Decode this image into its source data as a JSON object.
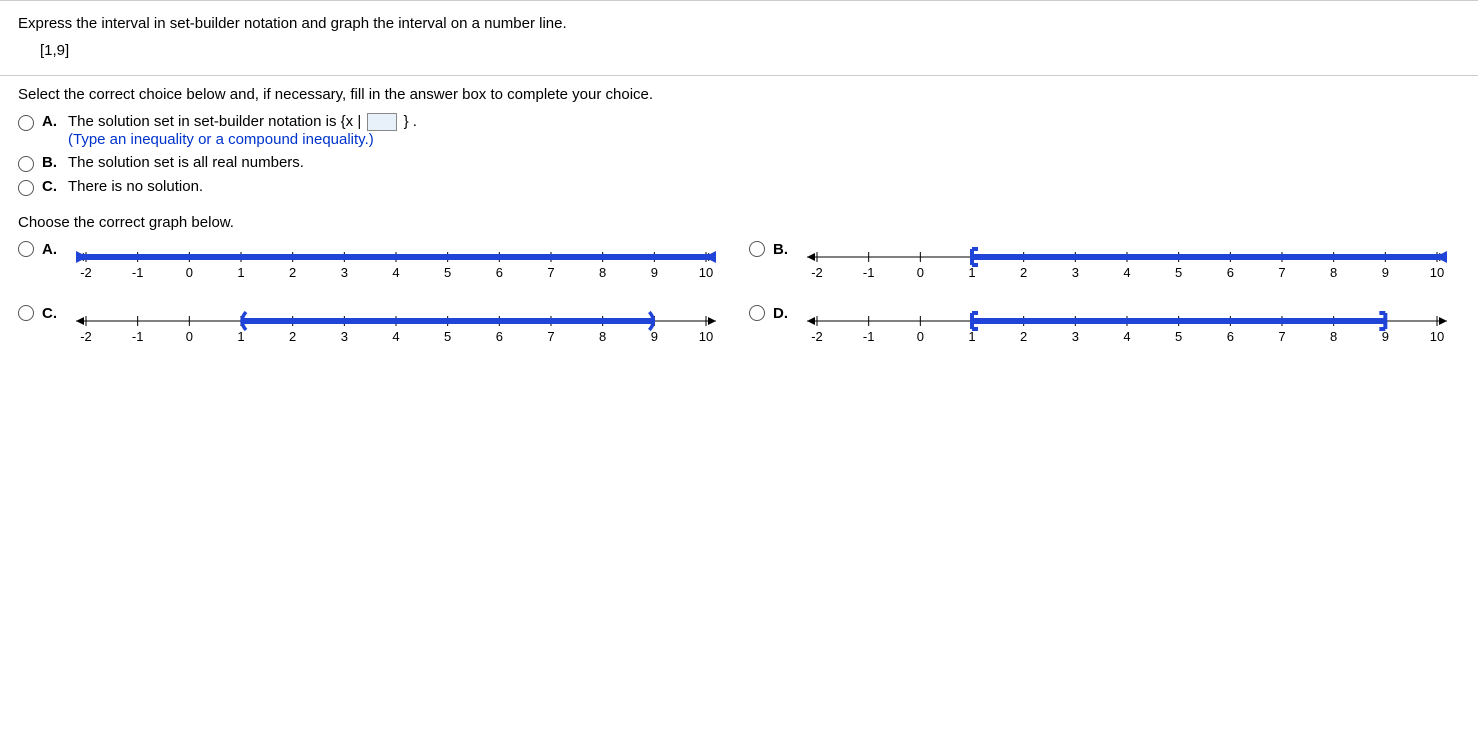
{
  "question": {
    "prompt": "Express the interval in set-builder notation and graph the interval on a number line.",
    "interval": "[1,9]"
  },
  "part1": {
    "instruction": "Select the correct choice below and, if necessary, fill in the answer box to complete your choice.",
    "choices": {
      "A": {
        "label": "A.",
        "pre": "The solution set in set-builder notation is ",
        "braceOpen": "{x | ",
        "braceClose": "} .",
        "hint": "(Type an inequality or a compound inequality.)"
      },
      "B": {
        "label": "B.",
        "text": "The solution set is all real numbers."
      },
      "C": {
        "label": "C.",
        "text": "There is no solution."
      }
    }
  },
  "part2": {
    "instruction": "Choose the correct graph below.",
    "choices": {
      "A": {
        "label": "A."
      },
      "B": {
        "label": "B."
      },
      "C": {
        "label": "C."
      },
      "D": {
        "label": "D."
      }
    },
    "axis": {
      "min": -2,
      "max": 10,
      "ticks": [
        -2,
        -1,
        0,
        1,
        2,
        3,
        4,
        5,
        6,
        7,
        8,
        9,
        10
      ]
    }
  },
  "chart_data": [
    {
      "type": "numberline",
      "label": "A",
      "xmin": -2,
      "xmax": 10,
      "shaded": {
        "from": "-inf",
        "to": "+inf"
      },
      "leftEnd": "arrow",
      "rightEnd": "arrow"
    },
    {
      "type": "numberline",
      "label": "B",
      "xmin": -2,
      "xmax": 10,
      "shaded": {
        "from": 1,
        "to": "+inf"
      },
      "leftEnd": "closed",
      "rightEnd": "arrow"
    },
    {
      "type": "numberline",
      "label": "C",
      "xmin": -2,
      "xmax": 10,
      "shaded": {
        "from": 1,
        "to": 9
      },
      "leftEnd": "open",
      "rightEnd": "open"
    },
    {
      "type": "numberline",
      "label": "D",
      "xmin": -2,
      "xmax": 10,
      "shaded": {
        "from": 1,
        "to": 9
      },
      "leftEnd": "closed",
      "rightEnd": "closed"
    }
  ],
  "colors": {
    "blue": "#2044d8"
  }
}
